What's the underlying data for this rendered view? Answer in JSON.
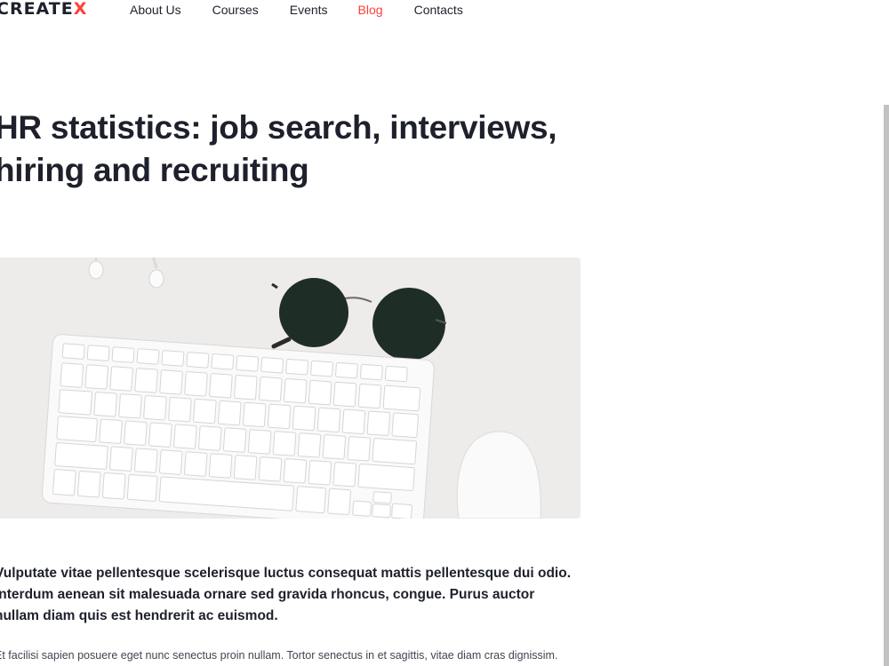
{
  "header": {
    "logo_text": "CREATE",
    "logo_mark": "X",
    "nav": [
      {
        "label": "About Us",
        "active": false
      },
      {
        "label": "Courses",
        "active": false
      },
      {
        "label": "Events",
        "active": false
      },
      {
        "label": "Blog",
        "active": true
      },
      {
        "label": "Contacts",
        "active": false
      }
    ]
  },
  "article": {
    "title": "HR statistics: job search, interviews, hiring and recruiting",
    "lead": "Vulputate vitae pellentesque scelerisque luctus consequat mattis pellentesque dui odio. Interdum aenean sit malesuada ornare sed gravida rhoncus, congue. Purus auctor nullam diam quis est hendrerit ac euismod.",
    "paragraph": "Et facilisi sapien posuere eget nunc senectus proin nullam. Tortor senectus in et sagittis, vitae diam cras dignissim."
  },
  "colors": {
    "accent": "#ff3f3a",
    "text_dark": "#1e212c",
    "text_body": "#424551"
  }
}
